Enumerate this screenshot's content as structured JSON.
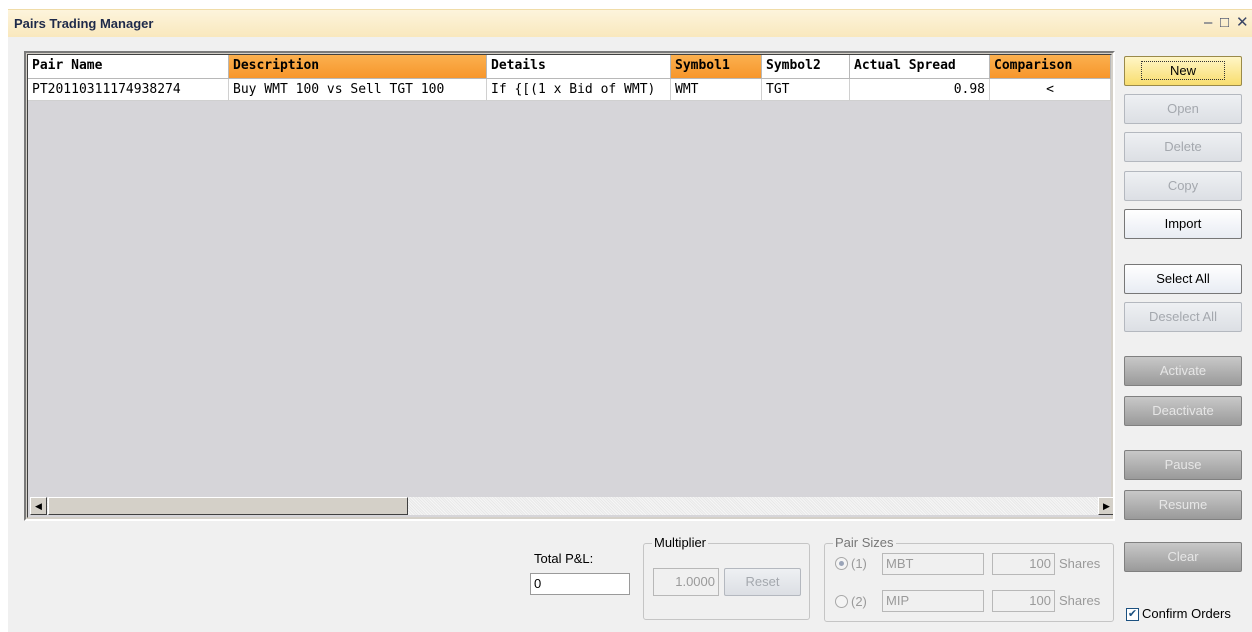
{
  "window": {
    "title": "Pairs Trading Manager",
    "minimize_glyph": "–",
    "maximize_glyph": "□",
    "close_glyph": "✕"
  },
  "grid": {
    "columns": [
      "Pair Name",
      "Description",
      "Details",
      "Symbol1",
      "Symbol2",
      "Actual Spread",
      "Comparison"
    ],
    "highlighted_columns": [
      "Description",
      "Symbol1",
      "Comparison"
    ],
    "rows": [
      [
        "PT20110311174938274",
        "Buy WMT 100 vs Sell TGT 100",
        "If {[(1 x Bid of WMT)",
        "WMT",
        "TGT",
        "0.98",
        "<"
      ]
    ],
    "scroll_left_glyph": "◀",
    "scroll_right_glyph": "▶"
  },
  "buttons": {
    "new": "New",
    "open": "Open",
    "delete": "Delete",
    "copy": "Copy",
    "import": "Import",
    "select_all": "Select All",
    "deselect_all": "Deselect All",
    "activate": "Activate",
    "deactivate": "Deactivate",
    "pause": "Pause",
    "resume": "Resume",
    "clear": "Clear"
  },
  "totals": {
    "label": "Total P&L:",
    "value": "0"
  },
  "multiplier": {
    "title": "Multiplier",
    "value": "1.0000",
    "reset_label": "Reset"
  },
  "pair_sizes": {
    "title": "Pair Sizes",
    "option1_label": "(1)",
    "option1_route": "MBT",
    "option1_shares": "100",
    "option2_label": "(2)",
    "option2_route": "MIP",
    "option2_shares": "100",
    "shares_unit": "Shares",
    "selected": 1
  },
  "confirm_orders": {
    "label": "Confirm Orders",
    "checked": true
  }
}
